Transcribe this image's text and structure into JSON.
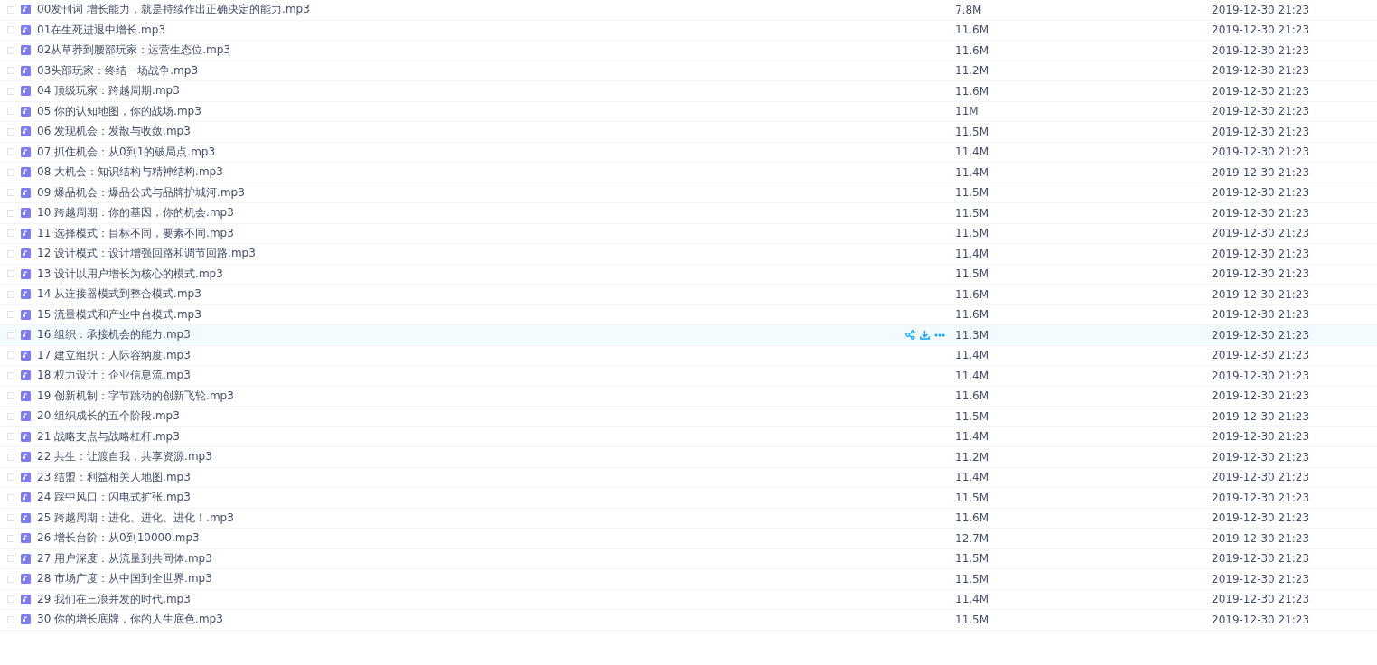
{
  "files": [
    {
      "name": "00发刊词 增长能力，就是持续作出正确决定的能力.mp3",
      "size": "7.8M",
      "modified": "2019-12-30 21:23",
      "checked": false,
      "hovered": false
    },
    {
      "name": "01在生死进退中增长.mp3",
      "size": "11.6M",
      "modified": "2019-12-30 21:23",
      "checked": false,
      "hovered": false
    },
    {
      "name": "02从草莽到腰部玩家：运营生态位.mp3",
      "size": "11.6M",
      "modified": "2019-12-30 21:23",
      "checked": false,
      "hovered": false
    },
    {
      "name": "03头部玩家：终结一场战争.mp3",
      "size": "11.2M",
      "modified": "2019-12-30 21:23",
      "checked": false,
      "hovered": false
    },
    {
      "name": "04 顶级玩家：跨越周期.mp3",
      "size": "11.6M",
      "modified": "2019-12-30 21:23",
      "checked": false,
      "hovered": false
    },
    {
      "name": "05 你的认知地图，你的战场.mp3",
      "size": "11M",
      "modified": "2019-12-30 21:23",
      "checked": false,
      "hovered": false
    },
    {
      "name": "06 发现机会：发散与收敛.mp3",
      "size": "11.5M",
      "modified": "2019-12-30 21:23",
      "checked": false,
      "hovered": false
    },
    {
      "name": "07 抓住机会：从0到1的破局点.mp3",
      "size": "11.4M",
      "modified": "2019-12-30 21:23",
      "checked": false,
      "hovered": false
    },
    {
      "name": "08 大机会：知识结构与精神结构.mp3",
      "size": "11.4M",
      "modified": "2019-12-30 21:23",
      "checked": false,
      "hovered": false
    },
    {
      "name": "09 爆品机会：爆品公式与品牌护城河.mp3",
      "size": "11.5M",
      "modified": "2019-12-30 21:23",
      "checked": false,
      "hovered": false
    },
    {
      "name": "10 跨越周期：你的基因，你的机会.mp3",
      "size": "11.5M",
      "modified": "2019-12-30 21:23",
      "checked": false,
      "hovered": false
    },
    {
      "name": "11 选择模式：目标不同，要素不同.mp3",
      "size": "11.5M",
      "modified": "2019-12-30 21:23",
      "checked": false,
      "hovered": false
    },
    {
      "name": "12 设计模式：设计增强回路和调节回路.mp3",
      "size": "11.4M",
      "modified": "2019-12-30 21:23",
      "checked": false,
      "hovered": false
    },
    {
      "name": "13 设计以用户增长为核心的模式.mp3",
      "size": "11.5M",
      "modified": "2019-12-30 21:23",
      "checked": false,
      "hovered": false
    },
    {
      "name": "14 从连接器模式到整合模式.mp3",
      "size": "11.6M",
      "modified": "2019-12-30 21:23",
      "checked": false,
      "hovered": false
    },
    {
      "name": "15 流量模式和产业中台模式.mp3",
      "size": "11.6M",
      "modified": "2019-12-30 21:23",
      "checked": false,
      "hovered": false
    },
    {
      "name": "16 组织：承接机会的能力.mp3",
      "size": "11.3M",
      "modified": "2019-12-30 21:23",
      "checked": false,
      "hovered": true
    },
    {
      "name": "17 建立组织：人际容纳度.mp3",
      "size": "11.4M",
      "modified": "2019-12-30 21:23",
      "checked": false,
      "hovered": false
    },
    {
      "name": "18 权力设计：企业信息流.mp3",
      "size": "11.4M",
      "modified": "2019-12-30 21:23",
      "checked": false,
      "hovered": false
    },
    {
      "name": "19 创新机制：字节跳动的创新飞轮.mp3",
      "size": "11.6M",
      "modified": "2019-12-30 21:23",
      "checked": false,
      "hovered": false
    },
    {
      "name": "20 组织成长的五个阶段.mp3",
      "size": "11.5M",
      "modified": "2019-12-30 21:23",
      "checked": false,
      "hovered": false
    },
    {
      "name": "21 战略支点与战略杠杆.mp3",
      "size": "11.4M",
      "modified": "2019-12-30 21:23",
      "checked": false,
      "hovered": false
    },
    {
      "name": "22 共生：让渡自我，共享资源.mp3",
      "size": "11.2M",
      "modified": "2019-12-30 21:23",
      "checked": false,
      "hovered": false
    },
    {
      "name": "23 结盟：利益相关人地图.mp3",
      "size": "11.4M",
      "modified": "2019-12-30 21:23",
      "checked": false,
      "hovered": false
    },
    {
      "name": "24 踩中风口：闪电式扩张.mp3",
      "size": "11.5M",
      "modified": "2019-12-30 21:23",
      "checked": false,
      "hovered": false
    },
    {
      "name": "25 跨越周期：进化、进化、进化！.mp3",
      "size": "11.6M",
      "modified": "2019-12-30 21:23",
      "checked": false,
      "hovered": false
    },
    {
      "name": "26 增长台阶：从0到10000.mp3",
      "size": "12.7M",
      "modified": "2019-12-30 21:23",
      "checked": false,
      "hovered": false
    },
    {
      "name": "27 用户深度：从流量到共同体.mp3",
      "size": "11.5M",
      "modified": "2019-12-30 21:23",
      "checked": false,
      "hovered": false
    },
    {
      "name": "28 市场广度：从中国到全世界.mp3",
      "size": "11.5M",
      "modified": "2019-12-30 21:23",
      "checked": false,
      "hovered": false
    },
    {
      "name": "29 我们在三浪并发的时代.mp3",
      "size": "11.4M",
      "modified": "2019-12-30 21:23",
      "checked": false,
      "hovered": false
    },
    {
      "name": "30 你的增长底牌，你的人生底色.mp3",
      "size": "11.5M",
      "modified": "2019-12-30 21:23",
      "checked": false,
      "hovered": false
    }
  ]
}
